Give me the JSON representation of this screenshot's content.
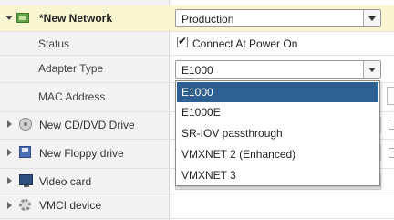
{
  "network_adapter": {
    "title": "*New Network",
    "network_value": "Production",
    "status_label": "Status",
    "connect_label": "Connect At Power On",
    "connect_checked": true,
    "adapter_type_label": "Adapter Type",
    "adapter_type_value": "E1000",
    "mac_address_label": "MAC Address",
    "icon": "network-card-icon"
  },
  "adapter_dropdown": {
    "options": [
      "E1000",
      "E1000E",
      "SR-IOV passthrough",
      "VMXNET 2 (Enhanced)",
      "VMXNET 3"
    ],
    "selected_index": 0
  },
  "devices": [
    {
      "label": "New CD/DVD Drive",
      "icon": "cd-dvd-icon"
    },
    {
      "label": "New Floppy drive",
      "icon": "floppy-icon"
    },
    {
      "label": "Video card",
      "icon": "monitor-icon"
    },
    {
      "label": "VMCI device",
      "icon": "gear-icon"
    }
  ],
  "colors": {
    "header_highlight": "#fbf6d2",
    "selected_option_bg": "#2d5f92",
    "label_column_bg": "#f3f3f3"
  }
}
